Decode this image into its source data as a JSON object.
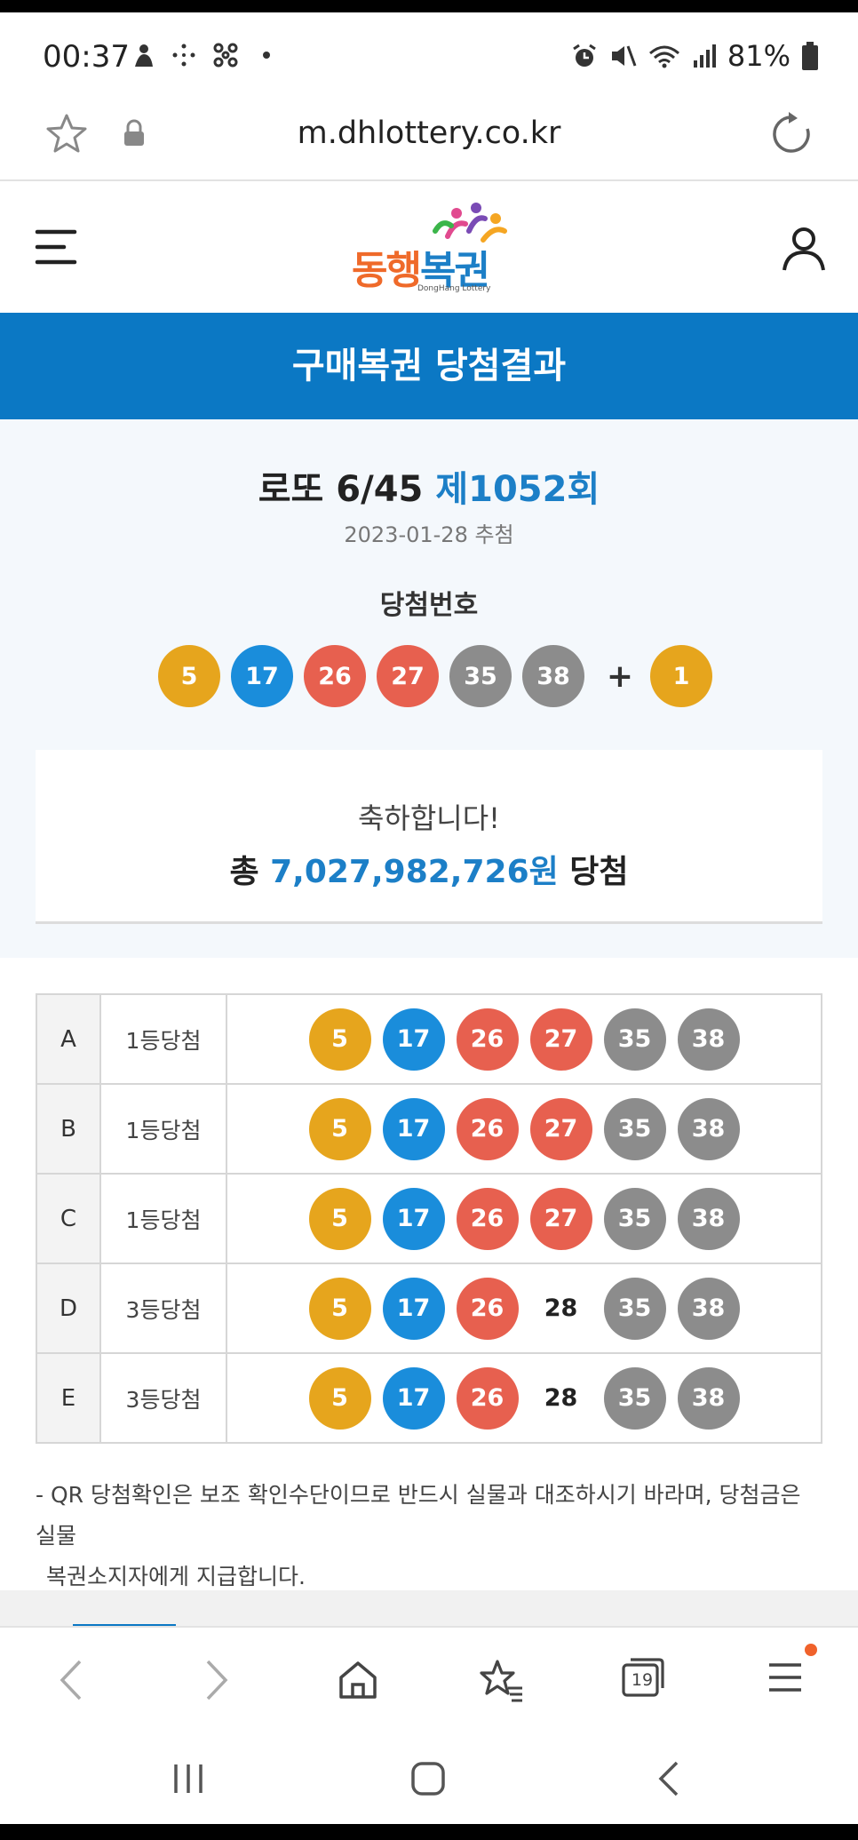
{
  "status_bar": {
    "time": "00:37",
    "battery": "81%",
    "icons": [
      "moon-person-icon",
      "sparkle-icon",
      "molecule-icon",
      "notification-dot-icon",
      "alarm-icon",
      "mute-icon",
      "wifi-icon",
      "signal-icon",
      "battery-icon"
    ]
  },
  "browser": {
    "url": "m.dhlottery.co.kr"
  },
  "site": {
    "logo_text_orange": "동행",
    "logo_text_blue": "복권",
    "logo_sub": "DongHang Lottery",
    "banner_title": "구매복권 당첨결과"
  },
  "draw": {
    "game": "로또 6/45",
    "round": "제1052회",
    "date": "2023-01-28 추첨",
    "label": "당첨번호",
    "numbers": [
      {
        "n": "5",
        "color": "#e6a51d"
      },
      {
        "n": "17",
        "color": "#1a8ddb"
      },
      {
        "n": "26",
        "color": "#e7604f"
      },
      {
        "n": "27",
        "color": "#e7604f"
      },
      {
        "n": "35",
        "color": "#8c8c8c"
      },
      {
        "n": "38",
        "color": "#8c8c8c"
      }
    ],
    "plus": "+",
    "bonus": {
      "n": "1",
      "color": "#e6a51d"
    }
  },
  "congrats": {
    "line1": "축하합니다!",
    "prefix": "총",
    "amount": "7,027,982,726원",
    "suffix": "당첨"
  },
  "results": [
    {
      "id": "A",
      "rank": "1등당첨",
      "nums": [
        [
          "5",
          "c1"
        ],
        [
          "17",
          "c2"
        ],
        [
          "26",
          "c3"
        ],
        [
          "27",
          "c3"
        ],
        [
          "35",
          "c4"
        ],
        [
          "38",
          "c4"
        ]
      ]
    },
    {
      "id": "B",
      "rank": "1등당첨",
      "nums": [
        [
          "5",
          "c1"
        ],
        [
          "17",
          "c2"
        ],
        [
          "26",
          "c3"
        ],
        [
          "27",
          "c3"
        ],
        [
          "35",
          "c4"
        ],
        [
          "38",
          "c4"
        ]
      ]
    },
    {
      "id": "C",
      "rank": "1등당첨",
      "nums": [
        [
          "5",
          "c1"
        ],
        [
          "17",
          "c2"
        ],
        [
          "26",
          "c3"
        ],
        [
          "27",
          "c3"
        ],
        [
          "35",
          "c4"
        ],
        [
          "38",
          "c4"
        ]
      ]
    },
    {
      "id": "D",
      "rank": "3등당첨",
      "nums": [
        [
          "5",
          "c1"
        ],
        [
          "17",
          "c2"
        ],
        [
          "26",
          "c3"
        ],
        [
          "28",
          "plain"
        ],
        [
          "35",
          "c4"
        ],
        [
          "38",
          "c4"
        ]
      ]
    },
    {
      "id": "E",
      "rank": "3등당첨",
      "nums": [
        [
          "5",
          "c1"
        ],
        [
          "17",
          "c2"
        ],
        [
          "26",
          "c3"
        ],
        [
          "28",
          "plain"
        ],
        [
          "35",
          "c4"
        ],
        [
          "38",
          "c4"
        ]
      ]
    }
  ],
  "note": {
    "line1": "- QR 당첨확인은 보조 확인수단이므로 반드시 실물과 대조하시기 바라며, 당첨금은 실물",
    "line2": "복권소지자에게 지급합니다."
  },
  "toolbar": {
    "tabs_count": "19"
  },
  "colors": {
    "brand_blue": "#0b78c4",
    "logo_orange": "#ef6a2a",
    "ball_yellow": "#e6a51d",
    "ball_blue": "#1a8ddb",
    "ball_red": "#e7604f",
    "ball_gray": "#8c8c8c"
  }
}
